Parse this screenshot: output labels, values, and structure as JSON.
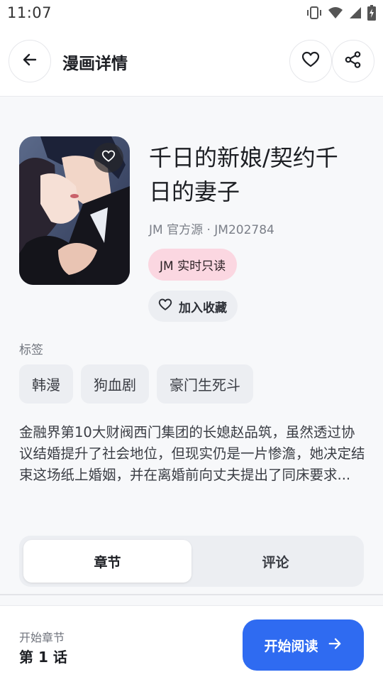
{
  "status_bar": {
    "time": "11:07",
    "icons": [
      "vibrate-icon",
      "wifi-icon",
      "signal-icon",
      "battery-charging-icon"
    ]
  },
  "header": {
    "title": "漫画详情",
    "back_icon": "arrow-left-icon",
    "favorite_icon": "heart-outline-icon",
    "share_icon": "share-icon"
  },
  "comic": {
    "title_line1": "千日的新娘/契约千",
    "title_line2": "日的妻子",
    "source": "JM 官方源 · JM202784",
    "realtime_pill": "JM 实时只读",
    "collect_label": "加入收藏",
    "tags_label": "标签",
    "tags": [
      "韩漫",
      "狗血剧",
      "豪门生死斗"
    ],
    "description": "金融界第10大财阀西门集团的长媳赵品筑，虽然透过协议结婚提升了社会地位，但现实仍是一片惨澹，她决定结束这场纸上婚姻，并在离婚前向丈夫提出了同床要求..."
  },
  "tabs": [
    {
      "label": "章节",
      "active": true
    },
    {
      "label": "评论",
      "active": false
    }
  ],
  "bottom": {
    "start_label": "开始章节",
    "start_chapter": "第 1 话",
    "read_button": "开始阅读"
  },
  "colors": {
    "accent": "#2f6bf1",
    "pill_pink": "#fbd7e1",
    "chip_bg": "#eceef2"
  }
}
